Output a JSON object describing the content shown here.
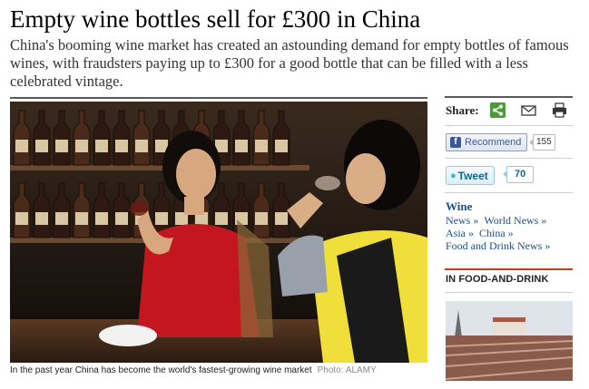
{
  "article": {
    "headline": "Empty wine bottles sell for £300 in China",
    "standfirst": "China's booming wine market has created an astounding demand for empty bottles of famous wines, with fraudsters paying up to £300 for a good bottle that can be filled with a less celebrated vintage.",
    "caption": "In the past year China has become the world's fastest-growing wine market",
    "credit": "Photo: ALAMY"
  },
  "sidebar": {
    "share_label": "Share:",
    "share_icons": [
      "share-icon",
      "email-icon",
      "print-icon"
    ],
    "recommend_label": "Recommend",
    "recommend_count": "155",
    "tweet_label": "Tweet",
    "tweet_count": "70",
    "wine_section_title": "Wine",
    "wine_links": [
      "News »",
      "World News »",
      "Asia »",
      "China »",
      "Food and Drink News »"
    ],
    "food_drink_title": "IN FOOD-AND-DRINK"
  },
  "colors": {
    "link_blue": "#1b4f8a",
    "share_green": "#4c9a3a",
    "facebook_blue": "#3b5998",
    "twitter_blue": "#186487",
    "section_red": "#c43a23"
  }
}
